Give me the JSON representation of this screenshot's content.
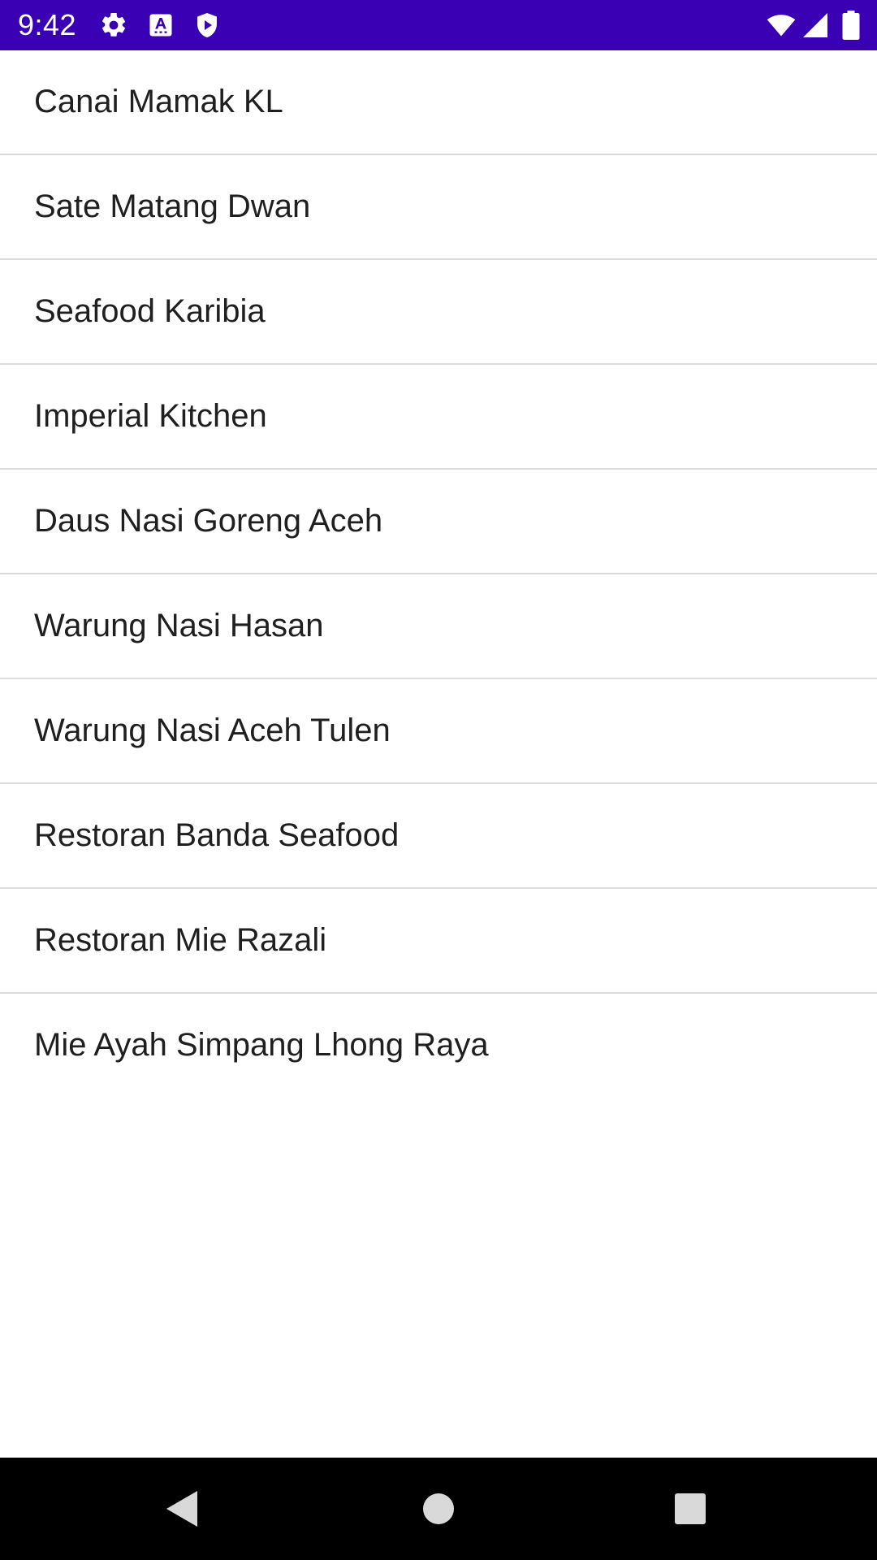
{
  "status_bar": {
    "time": "9:42",
    "background_color": "#3a00b3",
    "left_icons": [
      "gear-icon",
      "font-a-icon",
      "shield-icon"
    ],
    "right_icons": [
      "wifi-icon",
      "cell-signal-icon",
      "battery-icon"
    ]
  },
  "restaurants": [
    {
      "label": "Canai Mamak KL"
    },
    {
      "label": "Sate Matang Dwan"
    },
    {
      "label": "Seafood Karibia"
    },
    {
      "label": "Imperial Kitchen"
    },
    {
      "label": "Daus Nasi Goreng Aceh"
    },
    {
      "label": "Warung Nasi Hasan"
    },
    {
      "label": "Warung Nasi Aceh Tulen"
    },
    {
      "label": "Restoran Banda Seafood"
    },
    {
      "label": "Restoran Mie Razali"
    },
    {
      "label": "Mie Ayah Simpang Lhong Raya"
    }
  ],
  "navigation_bar": {
    "background_color": "#000000",
    "buttons": [
      "back-icon",
      "home-icon",
      "recents-icon"
    ]
  }
}
